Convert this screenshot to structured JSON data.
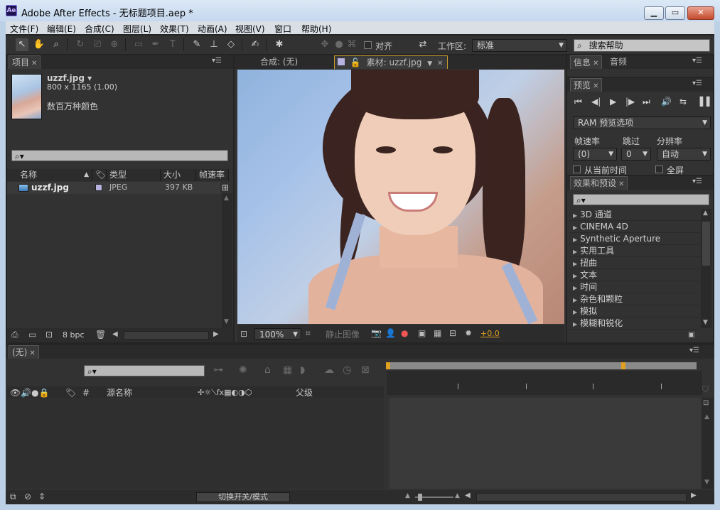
{
  "window": {
    "title": "Adobe After Effects - 无标题项目.aep *",
    "app_icon": "Ae"
  },
  "menubar": {
    "items": [
      "文件(F)",
      "编辑(E)",
      "合成(C)",
      "图层(L)",
      "效果(T)",
      "动画(A)",
      "视图(V)",
      "窗口",
      "帮助(H)"
    ]
  },
  "toolbar": {
    "snap_label": "对齐",
    "workspace_label": "工作区:",
    "workspace_value": "标准",
    "search_help_placeholder": "搜索帮助"
  },
  "project_panel": {
    "tab_label": "项目",
    "file_name": "uzzf.jpg ▾",
    "file_dimensions": "800 x 1165 (1.00)",
    "file_colors": "数百万种颜色",
    "columns": [
      "名称",
      "类型",
      "大小",
      "帧速率"
    ],
    "rows": [
      {
        "name": "uzzf.jpg",
        "type": "JPEG",
        "size": "397 KB"
      }
    ],
    "bit_depth": "8 bpc"
  },
  "viewer": {
    "tab_composition": "合成: (无)",
    "tab_footage": "素材: uzzf.jpg",
    "zoom": "100%",
    "still_label": "静止图像",
    "exposure": "+0.0"
  },
  "info_panel": {
    "tabs": [
      "信息",
      "音频"
    ]
  },
  "preview_panel": {
    "tab_label": "预览",
    "ram_options": "RAM 预览选项",
    "frame_rate_label": "帧速率",
    "skip_label": "跳过",
    "resolution_label": "分辨率",
    "frame_rate_value": "(0)",
    "skip_value": "0",
    "resolution_value": "自动",
    "from_current_time": "从当前时间",
    "full_screen": "全屏"
  },
  "effects_panel": {
    "tab_label": "效果和预设",
    "items": [
      "3D 通道",
      "CINEMA 4D",
      "Synthetic Aperture",
      "实用工具",
      "扭曲",
      "文本",
      "时间",
      "杂色和颗粒",
      "模拟",
      "模糊和锐化"
    ]
  },
  "timeline": {
    "tab_label": "(无)",
    "columns": {
      "hash": "#",
      "source_name": "源名称",
      "parent": "父级"
    },
    "toggle_label": "切换开关/模式"
  },
  "colors": {
    "panel_bg": "#323232",
    "accent_orange": "#e0a020",
    "highlight_blue": "#3a6ea5"
  }
}
